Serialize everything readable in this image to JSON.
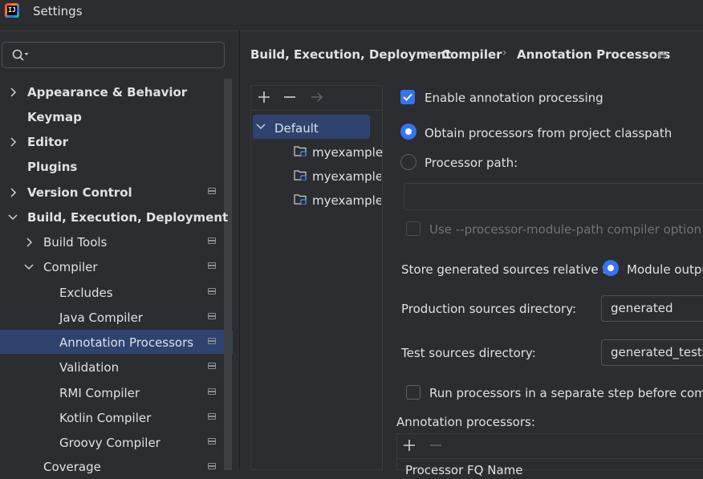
{
  "window": {
    "title": "Settings"
  },
  "search": {
    "placeholder": ""
  },
  "sidebar": {
    "items": [
      {
        "label": "Appearance & Behavior"
      },
      {
        "label": "Keymap"
      },
      {
        "label": "Editor"
      },
      {
        "label": "Plugins"
      },
      {
        "label": "Version Control"
      },
      {
        "label": "Build, Execution, Deployment"
      },
      {
        "label": "Build Tools"
      },
      {
        "label": "Compiler"
      },
      {
        "label": "Excludes"
      },
      {
        "label": "Java Compiler"
      },
      {
        "label": "Annotation Processors",
        "selected": true
      },
      {
        "label": "Validation"
      },
      {
        "label": "RMI Compiler"
      },
      {
        "label": "Kotlin Compiler"
      },
      {
        "label": "Groovy Compiler"
      },
      {
        "label": "Coverage"
      }
    ]
  },
  "breadcrumb": [
    "Build, Execution, Deployment",
    "Compiler",
    "Annotation Processors"
  ],
  "profiles": {
    "items": [
      {
        "label": "Default",
        "selected": true
      },
      {
        "label": "myexample"
      },
      {
        "label": "myexample.m"
      },
      {
        "label": "myexample.te"
      }
    ]
  },
  "settings": {
    "enable_annotation_processing": {
      "label": "Enable annotation processing",
      "checked": true
    },
    "obtain_from_classpath": {
      "label": "Obtain processors from project classpath",
      "selected": true
    },
    "processor_path": {
      "label": "Processor path:",
      "selected": false,
      "value": ""
    },
    "module_path_option": {
      "label": "Use --processor-module-path compiler option (for",
      "checked": false
    },
    "store_relative": {
      "label": "Store generated sources relative to:",
      "option_label": "Module outpu",
      "selected": true
    },
    "production_dir": {
      "label": "Production sources directory:",
      "value": "generated"
    },
    "test_dir": {
      "label": "Test sources directory:",
      "value": "generated_tests"
    },
    "separate_step": {
      "label": "Run processors in a separate step before compilin",
      "checked": false
    },
    "annotation_processors": {
      "label": "Annotation processors:",
      "column_header": "Processor FQ Name"
    }
  },
  "colors": {
    "accent": "#3574f0",
    "selection": "#2e436e",
    "background": "#2b2d30"
  }
}
